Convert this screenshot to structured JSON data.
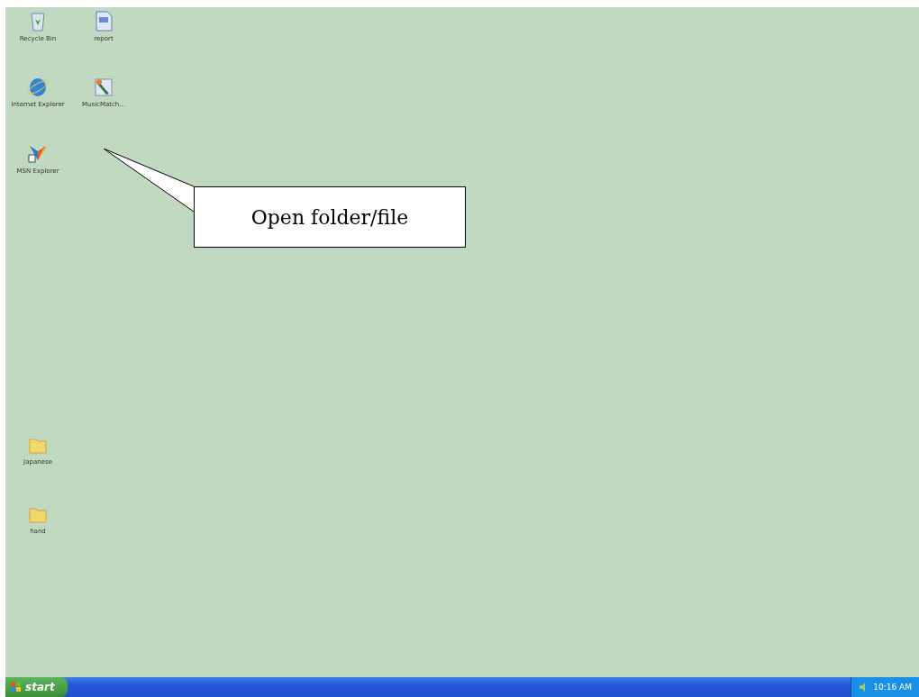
{
  "desktop_icons": [
    {
      "label": "Recycle Bin",
      "kind": "recycle"
    },
    {
      "label": "report",
      "kind": "document"
    },
    {
      "label": "Internet Explorer",
      "kind": "browser"
    },
    {
      "label": "MusicMatch...",
      "kind": "paint"
    },
    {
      "label": "MSN Explorer",
      "kind": "msn"
    },
    {
      "label": "Japanese",
      "kind": "folder"
    },
    {
      "label": "hand",
      "kind": "folder"
    }
  ],
  "callout": {
    "text": "Open folder/file"
  },
  "taskbar": {
    "start_label": "start",
    "clock": "10:16 AM"
  }
}
